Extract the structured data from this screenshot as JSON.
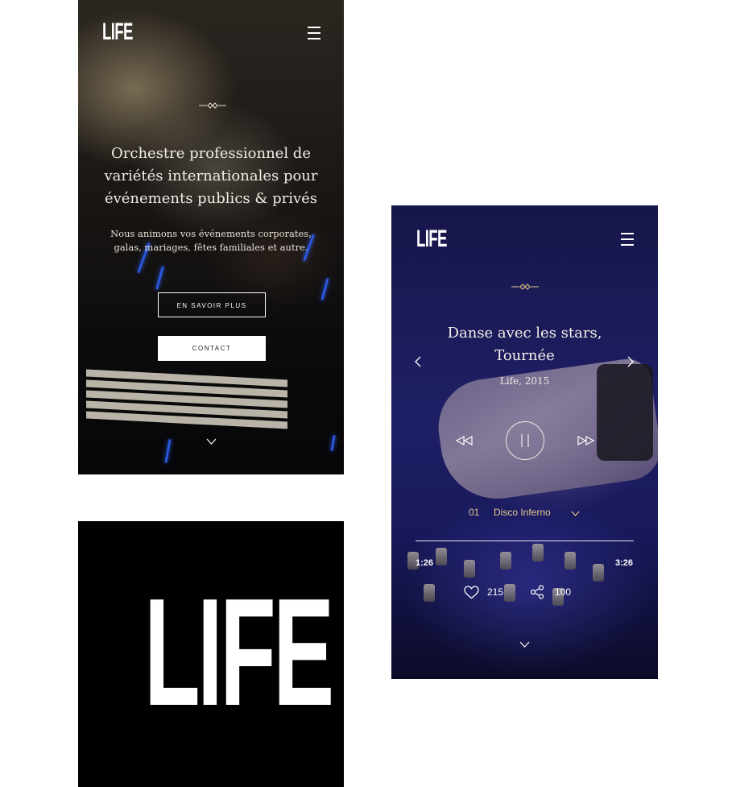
{
  "home_screen": {
    "logo": "LIFE",
    "title_lines": [
      "Orchestre professionnel de",
      "variétés internationales pour",
      "événements publics & privés"
    ],
    "subtitle_lines": [
      "Nous animons vos événements corporates,",
      "galas, mariages, fêtes familiales et autre."
    ],
    "buttons": {
      "learn_more": "EN SAVOIR PLUS",
      "contact": "CONTACT"
    },
    "icons": [
      "menu-icon",
      "ornament-icon",
      "chevron-down-icon"
    ]
  },
  "logo_card": {
    "logo": "LIFE"
  },
  "player_screen": {
    "logo": "LIFE",
    "song_title_lines": [
      "Danse avec les stars,",
      "Tournée"
    ],
    "album": "Life, 2015",
    "track": {
      "number": "01",
      "name": "Disco Inferno"
    },
    "time_elapsed": "1:26",
    "time_total": "3:26",
    "likes": "215",
    "shares": "100",
    "icons": [
      "menu-icon",
      "ornament-icon",
      "prev-arrow-icon",
      "next-arrow-icon",
      "rewind-icon",
      "pause-icon",
      "fast-forward-icon",
      "chevron-down-icon",
      "heart-icon",
      "share-icon"
    ]
  },
  "colors": {
    "accent_gold": "#e3c98c",
    "home_bg": "#0b0a0c",
    "player_bg": "#1f1f66"
  }
}
